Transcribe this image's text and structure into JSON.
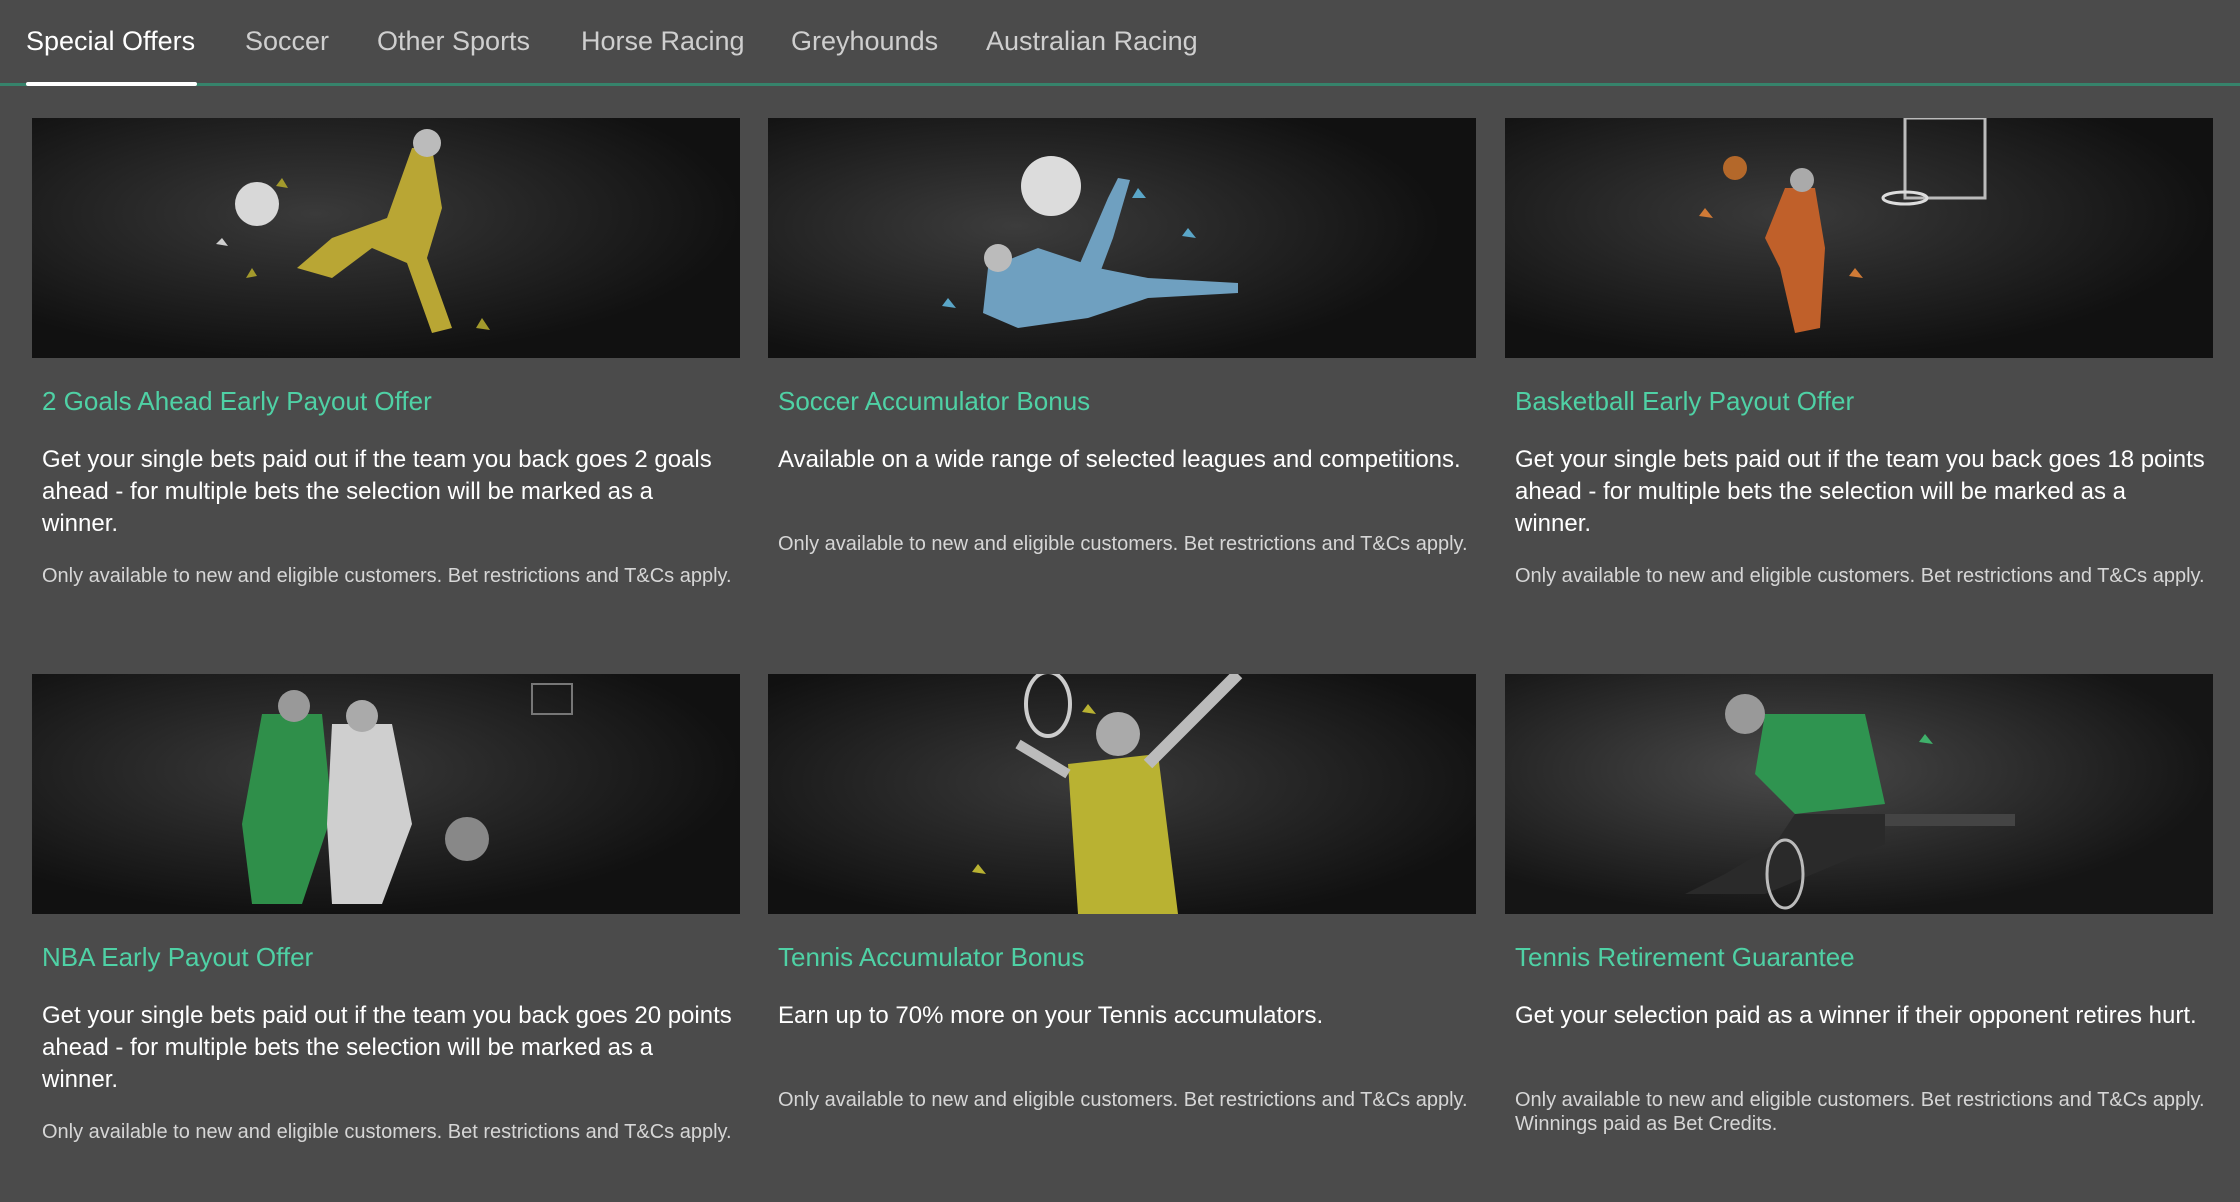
{
  "nav": {
    "tabs": [
      {
        "label": "Special Offers",
        "active": true
      },
      {
        "label": "Soccer",
        "active": false
      },
      {
        "label": "Other Sports",
        "active": false
      },
      {
        "label": "Horse Racing",
        "active": false
      },
      {
        "label": "Greyhounds",
        "active": false
      },
      {
        "label": "Australian Racing",
        "active": false
      }
    ]
  },
  "colors": {
    "background": "#4b4b4b",
    "accent_green": "#4fd1a5",
    "nav_border": "#36836b",
    "text_white": "#ffffff",
    "text_muted": "#d6d6d6"
  },
  "offers": [
    {
      "image": "soccer-player-kick-image",
      "title": "2 Goals Ahead Early Payout Offer",
      "description": "Get your single bets paid out if the team you back goes 2 goals ahead - for multiple bets the selection will be marked as a winner.",
      "terms": "Only available to new and eligible customers. Bet restrictions and T&Cs apply."
    },
    {
      "image": "soccer-bicycle-kick-image",
      "title": "Soccer Accumulator Bonus",
      "description": "Available on a wide range of selected leagues and competitions.",
      "terms": "Only available to new and eligible customers. Bet restrictions and T&Cs apply."
    },
    {
      "image": "basketball-dunk-image",
      "title": "Basketball Early Payout Offer",
      "description": "Get your single bets paid out if the team you back goes 18 points ahead - for multiple bets the selection will be marked as a winner.",
      "terms": "Only available to new and eligible customers. Bet restrictions and T&Cs apply."
    },
    {
      "image": "basketball-players-image",
      "title": "NBA Early Payout Offer",
      "description": "Get your single bets paid out if the team you back goes 20 points ahead - for multiple bets the selection will be marked as a winner.",
      "terms": "Only available to new and eligible customers. Bet restrictions and T&Cs apply."
    },
    {
      "image": "tennis-serve-image",
      "title": "Tennis Accumulator Bonus",
      "description": "Earn up to 70% more on your Tennis accumulators.",
      "terms": "Only available to new and eligible customers. Bet restrictions and T&Cs apply."
    },
    {
      "image": "tennis-player-seated-image",
      "title": "Tennis Retirement Guarantee",
      "description": "Get your selection paid as a winner if their opponent retires hurt.",
      "terms": "Only available to new and eligible customers. Bet restrictions and T&Cs apply. Winnings paid as Bet Credits."
    }
  ]
}
